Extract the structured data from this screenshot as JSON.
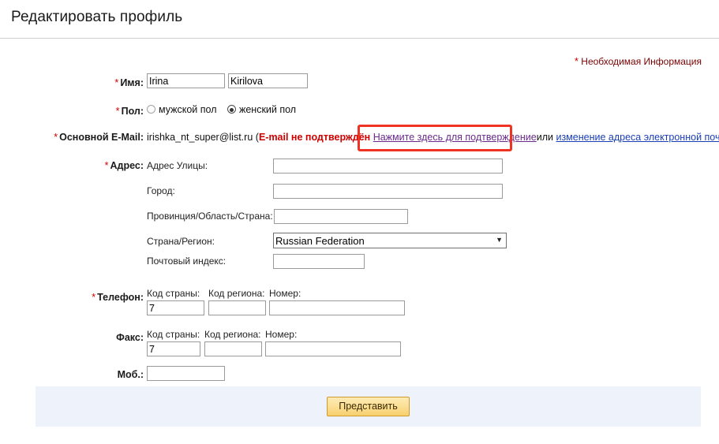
{
  "header": {
    "title": "Редактировать профиль"
  },
  "required_note": {
    "star": "*",
    "text": "Необходимая Информация"
  },
  "form": {
    "name": {
      "label": "Имя:",
      "star": "*",
      "first_value": "Irina",
      "last_value": "Kirilova"
    },
    "gender": {
      "label": "Пол:",
      "star": "*",
      "options": [
        {
          "label": "мужской пол",
          "checked": false
        },
        {
          "label": "женский пол",
          "checked": true
        }
      ]
    },
    "email": {
      "label": "Основной E-Mail:",
      "star": "*",
      "value": "irishka_nt_super@list.ru",
      "open_paren": "(",
      "warning": "E-mail не подтверждён",
      "confirm_link": "Нажмите здесь для подтверждение",
      "or": "или",
      "change_link": "изменение адреса электронной почты",
      "close_paren": ")"
    },
    "address": {
      "label": "Адрес:",
      "star": "*",
      "street_label": "Адрес Улицы:",
      "street_value": "",
      "city_label": "Город:",
      "city_value": "",
      "province_label": "Провинция/Область/Страна:",
      "province_value": "",
      "country_label": "Страна/Регион:",
      "country_value": "Russian Federation",
      "country_options": [
        "Russian Federation"
      ],
      "postal_label": "Почтовый индекс:",
      "postal_value": ""
    },
    "phone": {
      "label": "Телефон:",
      "star": "*",
      "country_code_label": "Код страны:",
      "country_code_value": "7",
      "area_code_label": "Код региона:",
      "area_code_value": "",
      "number_label": "Номер:",
      "number_value": ""
    },
    "fax": {
      "label": "Факс:",
      "country_code_label": "Код страны:",
      "country_code_value": "7",
      "area_code_label": "Код региона:",
      "area_code_value": "",
      "number_label": "Номер:",
      "number_value": ""
    },
    "mobile": {
      "label": "Моб.:",
      "value": ""
    }
  },
  "footer": {
    "submit_label": "Представить"
  },
  "colors": {
    "required_star": "#cc0000",
    "warning": "#d00000",
    "link_visited": "#6a2a8c",
    "link": "#1a3fb5",
    "highlight": "#ee3322",
    "footer_band": "#eef2fa",
    "submit_border": "#d09a2a"
  }
}
